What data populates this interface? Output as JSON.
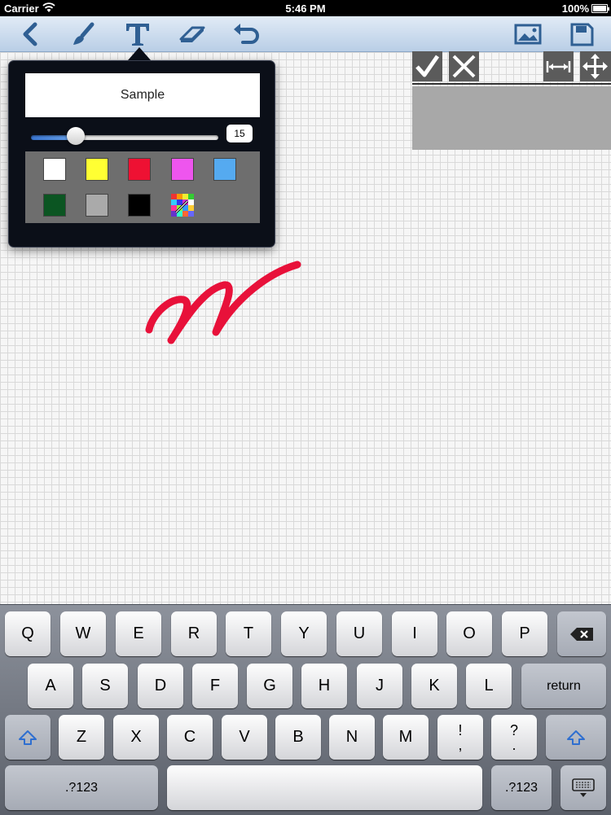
{
  "status_bar": {
    "carrier": "Carrier",
    "time": "5:46 PM",
    "battery": "100%"
  },
  "toolbar": {
    "left_icons": [
      "back-chevron-icon",
      "brush-icon",
      "text-icon",
      "eraser-icon",
      "undo-icon"
    ],
    "right_icons": [
      "image-icon",
      "save-icon"
    ],
    "accent": "#2f5f93"
  },
  "text_popover": {
    "sample_text": "Sample",
    "size_value": "15",
    "size_fraction": 0.2,
    "colors": [
      "#ffffff",
      "#ffff33",
      "#ee1133",
      "#ee55ee",
      "#55aaf0",
      "#0b5522",
      "#aaaaaa",
      "#000000"
    ],
    "custom_color_icon": "color-picker-icon"
  },
  "text_box_controls": {
    "icons": [
      "checkmark-icon",
      "close-icon",
      "resize-horizontal-icon",
      "move-icon"
    ]
  },
  "drawing": {
    "stroke_color": "#e8113a"
  },
  "keyboard": {
    "row1": [
      "Q",
      "W",
      "E",
      "R",
      "T",
      "Y",
      "U",
      "I",
      "O",
      "P"
    ],
    "row2": [
      "A",
      "S",
      "D",
      "F",
      "G",
      "H",
      "J",
      "K",
      "L"
    ],
    "row3": [
      "Z",
      "X",
      "C",
      "V",
      "B",
      "N",
      "M"
    ],
    "punct1": [
      "!",
      ","
    ],
    "punct2": [
      "?",
      "."
    ],
    "return_label": "return",
    "numbers_left": ".?123",
    "numbers_right": ".?123",
    "icons": [
      "backspace-icon",
      "shift-icon",
      "keyboard-dismiss-icon"
    ]
  }
}
